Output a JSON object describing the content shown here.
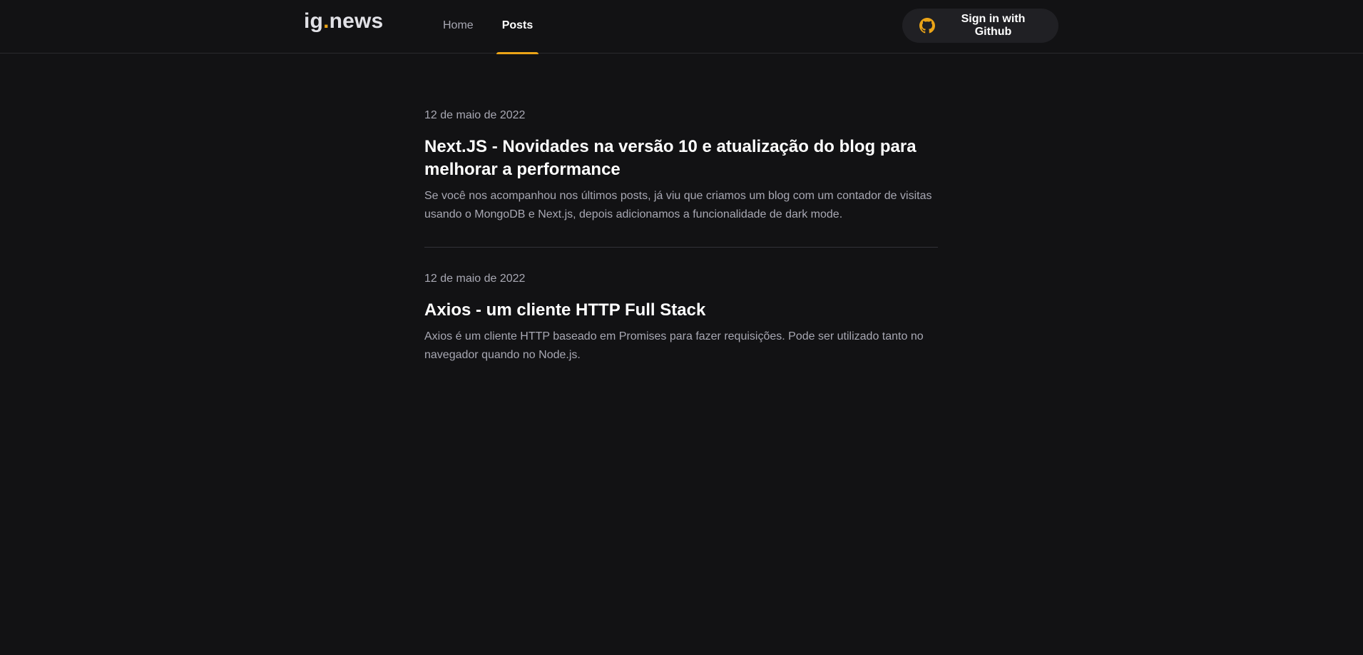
{
  "header": {
    "logo_text": "ig",
    "logo_dot": ".",
    "logo_suffix": "news",
    "nav": [
      {
        "label": "Home",
        "active": false
      },
      {
        "label": "Posts",
        "active": true
      }
    ],
    "signin_label": "Sign in with Github",
    "signin_icon": "github-icon",
    "accent_color": "#eba417"
  },
  "posts": [
    {
      "date": "12 de maio de 2022",
      "title": "Next.JS - Novidades na versão 10 e atualização do blog para melhorar a performance",
      "excerpt": "Se você nos acompanhou nos últimos posts, já viu que criamos um blog com um contador de visitas usando o MongoDB e Next.js, depois adicionamos a funcionalidade de dark mode."
    },
    {
      "date": "12 de maio de 2022",
      "title": "Axios - um cliente HTTP Full Stack",
      "excerpt": "Axios é um cliente HTTP baseado em Promises para fazer requisições. Pode ser utilizado tanto no navegador quando no Node.js."
    }
  ]
}
